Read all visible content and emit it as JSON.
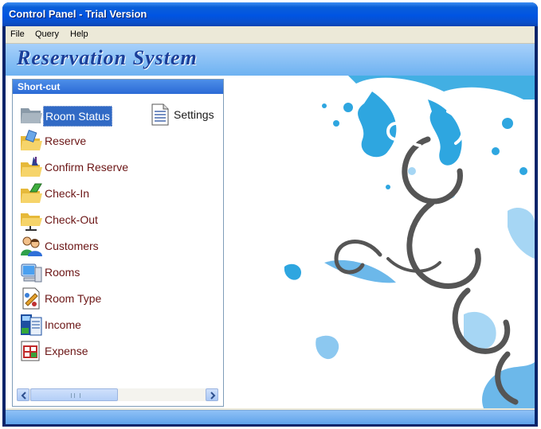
{
  "window": {
    "title": "Control Panel - Trial Version"
  },
  "menu": [
    "File",
    "Query",
    "Help"
  ],
  "banner": {
    "title": "Reservation System"
  },
  "panel": {
    "header": "Short-cut",
    "items": [
      {
        "label": "Room Status",
        "icon": "room-status-icon",
        "selected": true
      },
      {
        "label": "Settings",
        "icon": "settings-document-icon"
      },
      {
        "label": "Reserve",
        "icon": "reserve-folder-icon"
      },
      {
        "label": "Confirm Reserve",
        "icon": "confirm-reserve-folder-icon"
      },
      {
        "label": "Check-In",
        "icon": "check-in-folder-icon"
      },
      {
        "label": "Check-Out",
        "icon": "check-out-folder-icon"
      },
      {
        "label": "Customers",
        "icon": "customers-icon"
      },
      {
        "label": "Rooms",
        "icon": "computer-icon"
      },
      {
        "label": "Room Type",
        "icon": "room-type-icon"
      },
      {
        "label": "Income",
        "icon": "income-icon"
      },
      {
        "label": "Expense",
        "icon": "expense-icon"
      }
    ]
  },
  "colors": {
    "accent": "#0054e3",
    "label": "#6b1515",
    "selection": "#316ac5",
    "decor": "#2ea6e0"
  }
}
